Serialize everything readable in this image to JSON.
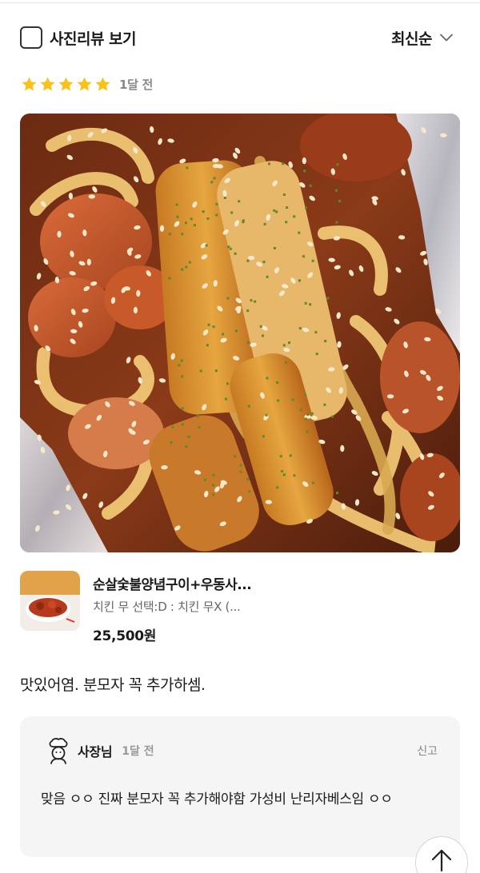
{
  "filter": {
    "photo_review_label": "사진리뷰 보기",
    "photo_review_checked": false,
    "sort_label": "최신순"
  },
  "review": {
    "rating": 5,
    "time": "1달 전",
    "text": "맛있어염. 분모자 꼭 추가하셈."
  },
  "order": {
    "name": "순살숯불양념구이+우동사...",
    "option": "치킨 무 선택:D : 치킨 무X (...",
    "price": "25,500원"
  },
  "owner_reply": {
    "name": "사장님",
    "time": "1달 전",
    "report_label": "신고",
    "text": "맞음 ㅇㅇ 진짜 분모자 꼭 추가해야함 가성비 난리자베스임 ㅇㅇ"
  },
  "colors": {
    "star": "#f9c21a",
    "text": "#1a1a1a",
    "muted": "#888888",
    "reply_bg": "#f5f5f5"
  },
  "icons": {
    "checkbox": "checkbox-empty-icon",
    "sort": "chevron-down-icon",
    "star": "star-icon",
    "owner": "chef-avatar-icon",
    "scroll": "arrow-up-icon"
  }
}
